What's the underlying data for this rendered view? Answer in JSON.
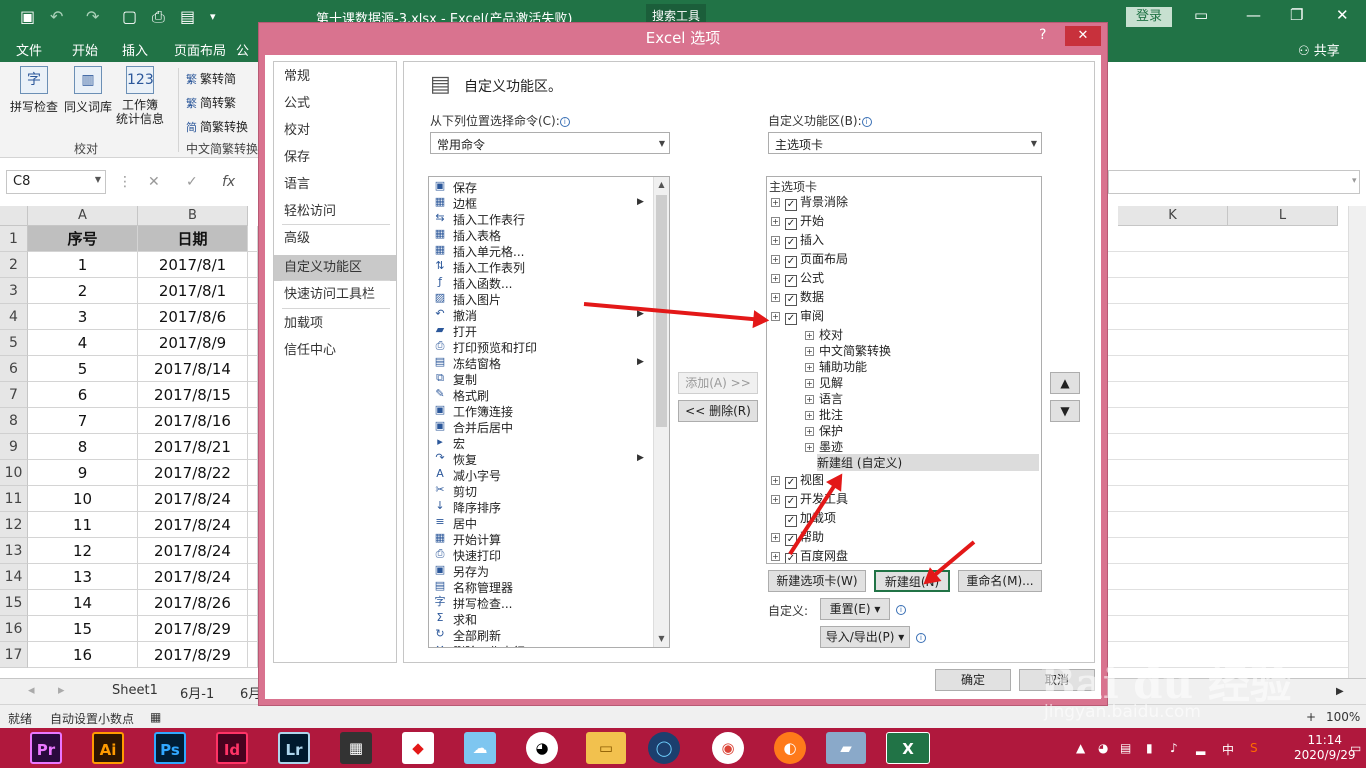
{
  "window": {
    "title": "第十课数据源-3.xlsx  -  Excel(产品激活失败)",
    "search_tools": "搜索工具",
    "login": "登录",
    "share": "共享"
  },
  "ribbon_tabs": [
    "文件",
    "开始",
    "插入",
    "页面布局",
    "公"
  ],
  "ribbon": {
    "spell": "拼写检查",
    "thesaurus": "同义词库",
    "stats_line1": "工作簿",
    "stats_line2": "统计信息",
    "proof_group": "校对",
    "trad_to_simp": "繁转简",
    "simp_to_trad": "简转繁",
    "convert": "简繁转换",
    "chinese_group": "中文简繁转换"
  },
  "formula_bar": {
    "name_box": "C8",
    "fx": "fx"
  },
  "columns": [
    "A",
    "B",
    "K",
    "L"
  ],
  "rows": [
    "1",
    "2",
    "3",
    "4",
    "5",
    "6",
    "7",
    "8",
    "9",
    "10",
    "11",
    "12",
    "13",
    "14",
    "15",
    "16",
    "17"
  ],
  "table": {
    "headers": [
      "序号",
      "日期"
    ],
    "data": [
      [
        "1",
        "2017/8/1"
      ],
      [
        "2",
        "2017/8/1"
      ],
      [
        "3",
        "2017/8/6"
      ],
      [
        "4",
        "2017/8/9"
      ],
      [
        "5",
        "2017/8/14"
      ],
      [
        "6",
        "2017/8/15"
      ],
      [
        "7",
        "2017/8/16"
      ],
      [
        "8",
        "2017/8/21"
      ],
      [
        "9",
        "2017/8/22"
      ],
      [
        "10",
        "2017/8/24"
      ],
      [
        "11",
        "2017/8/24"
      ],
      [
        "12",
        "2017/8/24"
      ],
      [
        "13",
        "2017/8/24"
      ],
      [
        "14",
        "2017/8/26"
      ],
      [
        "15",
        "2017/8/29"
      ],
      [
        "16",
        "2017/8/29"
      ]
    ]
  },
  "sheets": [
    "Sheet1",
    "6月-1",
    "6月"
  ],
  "status": {
    "ready": "就绪",
    "auto_decimal": "自动设置小数点",
    "zoom": "100%"
  },
  "clock": {
    "time": "11:14",
    "date": "2020/9/29"
  },
  "tray_ime": "中",
  "taskbar_apps": [
    "Pr",
    "Ai",
    "Ps",
    "Id",
    "Lr"
  ],
  "dialog": {
    "title": "Excel 选项",
    "help": "?",
    "nav": [
      "常规",
      "公式",
      "校对",
      "保存",
      "语言",
      "轻松访问",
      "高级",
      "自定义功能区",
      "快速访问工具栏",
      "加载项",
      "信任中心"
    ],
    "heading": "自定义功能区。",
    "choose_label": "从下列位置选择命令(C):",
    "choose_value": "常用命令",
    "customize_label": "自定义功能区(B):",
    "customize_value": "主选项卡",
    "commands": [
      "保存",
      "边框",
      "插入工作表行",
      "插入表格",
      "插入单元格...",
      "插入工作表列",
      "插入函数...",
      "插入图片",
      "撤消",
      "打开",
      "打印预览和打印",
      "冻结窗格",
      "复制",
      "格式刷",
      "工作簿连接",
      "合并后居中",
      "宏",
      "恢复",
      "减小字号",
      "剪切",
      "降序排序",
      "居中",
      "开始计算",
      "快速打印",
      "另存为",
      "名称管理器",
      "拼写检查...",
      "求和",
      "全部刷新",
      "删除工作表行"
    ],
    "tree_header": "主选项卡",
    "tree_top": [
      "背景消除",
      "开始",
      "插入",
      "页面布局",
      "公式",
      "数据",
      "审阅"
    ],
    "tree_review_children": [
      "校对",
      "中文简繁转换",
      "辅助功能",
      "见解",
      "语言",
      "批注",
      "保护",
      "墨迹"
    ],
    "new_group_custom": "新建组 (自定义)",
    "tree_bottom": [
      "视图",
      "开发工具",
      "加载项",
      "帮助",
      "百度网盘"
    ],
    "add_btn": "添加(A) >>",
    "remove_btn": "<< 删除(R)",
    "new_tab_btn": "新建选项卡(W)",
    "new_group_btn": "新建组(N)",
    "rename_btn": "重命名(M)...",
    "custom_label": "自定义:",
    "reset_btn": "重置(E)",
    "import_export_btn": "导入/导出(P)",
    "ok_btn": "确定",
    "cancel_btn": "取消"
  },
  "watermark": {
    "brand": "Bai du 经验",
    "url": "jingyan.baidu.com"
  },
  "colors": {
    "excel_green": "#217346",
    "dialog_pink": "#d9738f",
    "annotation_red": "#e31818",
    "taskbar": "#b0183d"
  }
}
